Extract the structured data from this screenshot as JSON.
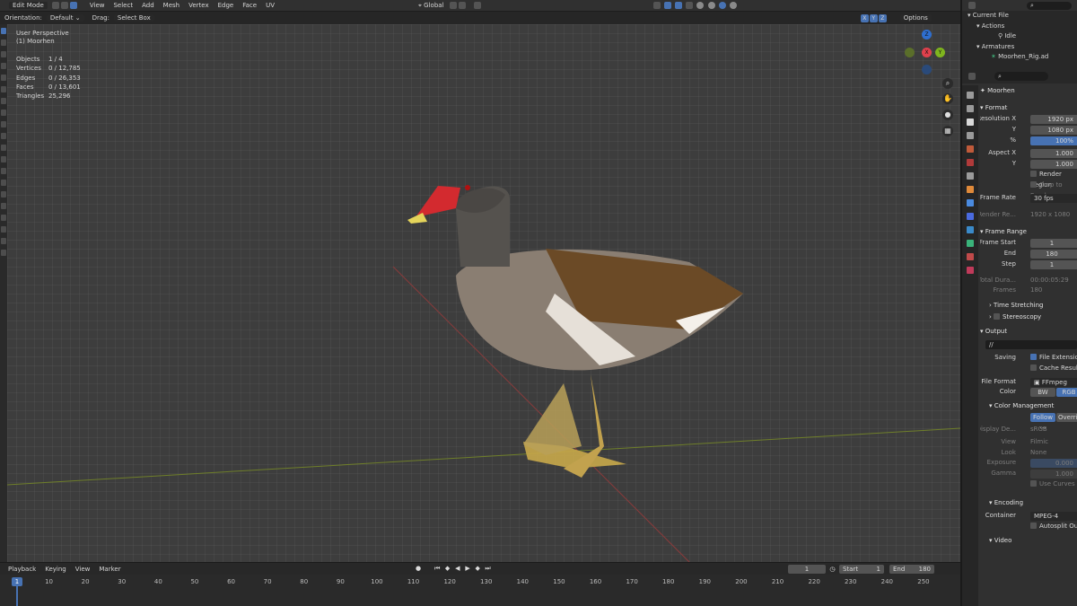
{
  "header": {
    "mode": "Edit Mode",
    "menus": [
      "View",
      "Select",
      "Add",
      "Mesh",
      "Vertex",
      "Edge",
      "Face",
      "UV"
    ],
    "transform_orientation": "Global"
  },
  "subheader": {
    "orientation_label": "Orientation:",
    "orientation_value": "Default",
    "drag_label": "Drag:",
    "drag_value": "Select Box",
    "axes": [
      "X",
      "Y",
      "Z"
    ],
    "options_label": "Options"
  },
  "viewport": {
    "perspective": "User Perspective",
    "object_name": "(1) Moorhen",
    "stats": [
      {
        "label": "Objects",
        "value": "1 / 4"
      },
      {
        "label": "Vertices",
        "value": "0 / 12,785"
      },
      {
        "label": "Edges",
        "value": "0 / 26,353"
      },
      {
        "label": "Faces",
        "value": "0 / 13,601"
      },
      {
        "label": "Triangles",
        "value": "25,296"
      }
    ],
    "gizmo": {
      "z": "Z",
      "y": "Y",
      "x": "X"
    }
  },
  "timeline": {
    "menus": [
      "Playback",
      "Keying",
      "View",
      "Marker"
    ],
    "current_frame": "1",
    "start_label": "Start",
    "start_value": "1",
    "end_label": "End",
    "end_value": "180",
    "ticks": [
      "1",
      "10",
      "20",
      "30",
      "40",
      "50",
      "60",
      "70",
      "80",
      "90",
      "100",
      "110",
      "120",
      "130",
      "140",
      "150",
      "160",
      "170",
      "180",
      "190",
      "200",
      "210",
      "220",
      "230",
      "240",
      "250"
    ]
  },
  "outliner": {
    "rows": [
      "Current File",
      "Actions",
      "Idle",
      "Armatures",
      "Moorhen_Rig.ad"
    ]
  },
  "properties": {
    "scene_name": "Moorhen",
    "format_title": "Format",
    "resolution_x_label": "Resolution X",
    "resolution_x": "1920 px",
    "y_label": "Y",
    "resolution_y": "1080 px",
    "percent_label": "%",
    "percent": "100%",
    "aspect_x_label": "Aspect X",
    "aspect_x": "1.000",
    "aspect_y": "1.000",
    "render_region": "Render Region",
    "crop_to_render": "Crop to Render",
    "frame_rate_label": "Frame Rate",
    "frame_rate": "30 fps",
    "render_res_label": "Render Re...",
    "render_res": "1920 x 1080",
    "frame_range_title": "Frame Range",
    "frame_start_label": "Frame Start",
    "frame_start": "1",
    "end_label": "End",
    "frame_end": "180",
    "step_label": "Step",
    "step": "1",
    "total_dur_label": "Total Dura...",
    "total_dur": "00:00:05:29",
    "frames_label": "Frames",
    "frames": "180",
    "time_stretching": "Time Stretching",
    "stereoscopy": "Stereoscopy",
    "output_title": "Output",
    "output_path": "//",
    "saving_label": "Saving",
    "file_extensions": "File Extensions",
    "cache_result": "Cache Result",
    "file_format_label": "File Format",
    "file_format": "FFmpeg Vi...",
    "color_label": "Color",
    "color_bw": "BW",
    "color_rgb": "RGB",
    "color_mgmt_title": "Color Management",
    "follow_scene": "Follow ...",
    "override": "Override",
    "display_dev_label": "Display De...",
    "display_dev": "sRGB",
    "view_label": "View",
    "view": "Filmic",
    "look_label": "Look",
    "look": "None",
    "exposure_label": "Exposure",
    "exposure": "0.000",
    "gamma_label": "Gamma",
    "gamma": "1.000",
    "use_curves": "Use Curves",
    "encoding_title": "Encoding",
    "container_label": "Container",
    "container": "MPEG-4",
    "autosplit": "Autosplit Output",
    "video_title": "Video"
  }
}
